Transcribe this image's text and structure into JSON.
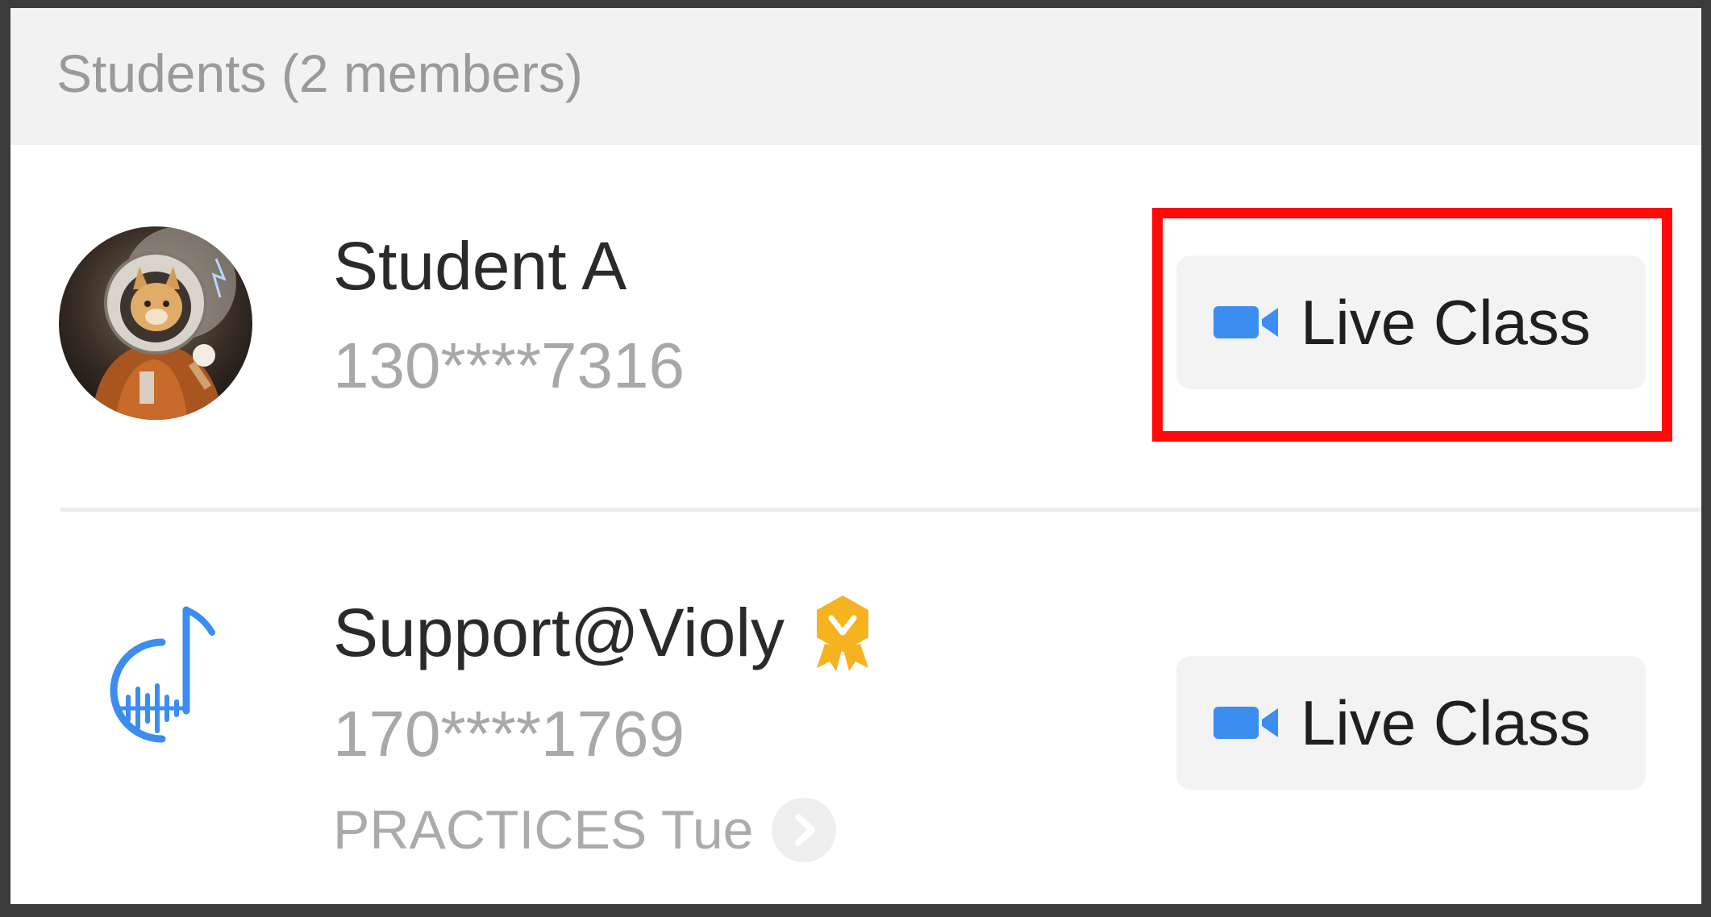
{
  "section": {
    "title": "Students (2 members)"
  },
  "students": [
    {
      "name": "Student A",
      "phone": "130****7316",
      "action_label": "Live Class"
    },
    {
      "name": "Support@Violy",
      "phone": "170****1769",
      "practice_label": "PRACTICES Tue",
      "action_label": "Live Class"
    }
  ],
  "colors": {
    "accent": "#3b8df0",
    "highlight": "#ff0a0a",
    "badge": "#f5b320"
  },
  "icons": {
    "camera": "video-camera-icon",
    "verified": "verified-badge-icon",
    "chevron": "chevron-right-icon",
    "music": "music-note-logo-icon"
  }
}
